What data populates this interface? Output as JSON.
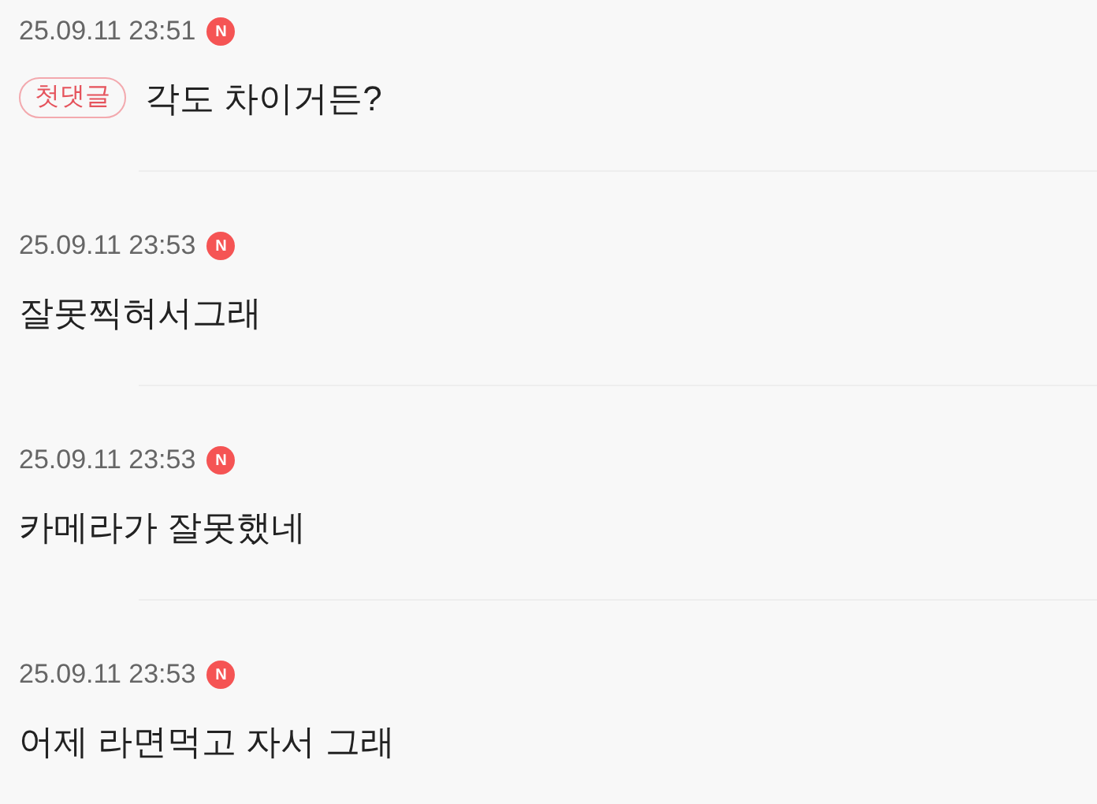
{
  "comments": [
    {
      "date": "25.09.11 23:51",
      "badge": "N",
      "tag": "첫댓글",
      "text": "각도 차이거든?"
    },
    {
      "date": "25.09.11 23:53",
      "badge": "N",
      "text": "잘못찍혀서그래"
    },
    {
      "date": "25.09.11 23:53",
      "badge": "N",
      "text": "카메라가 잘못했네"
    },
    {
      "date": "25.09.11 23:53",
      "badge": "N",
      "text": "어제 라면먹고 자서 그래"
    }
  ]
}
